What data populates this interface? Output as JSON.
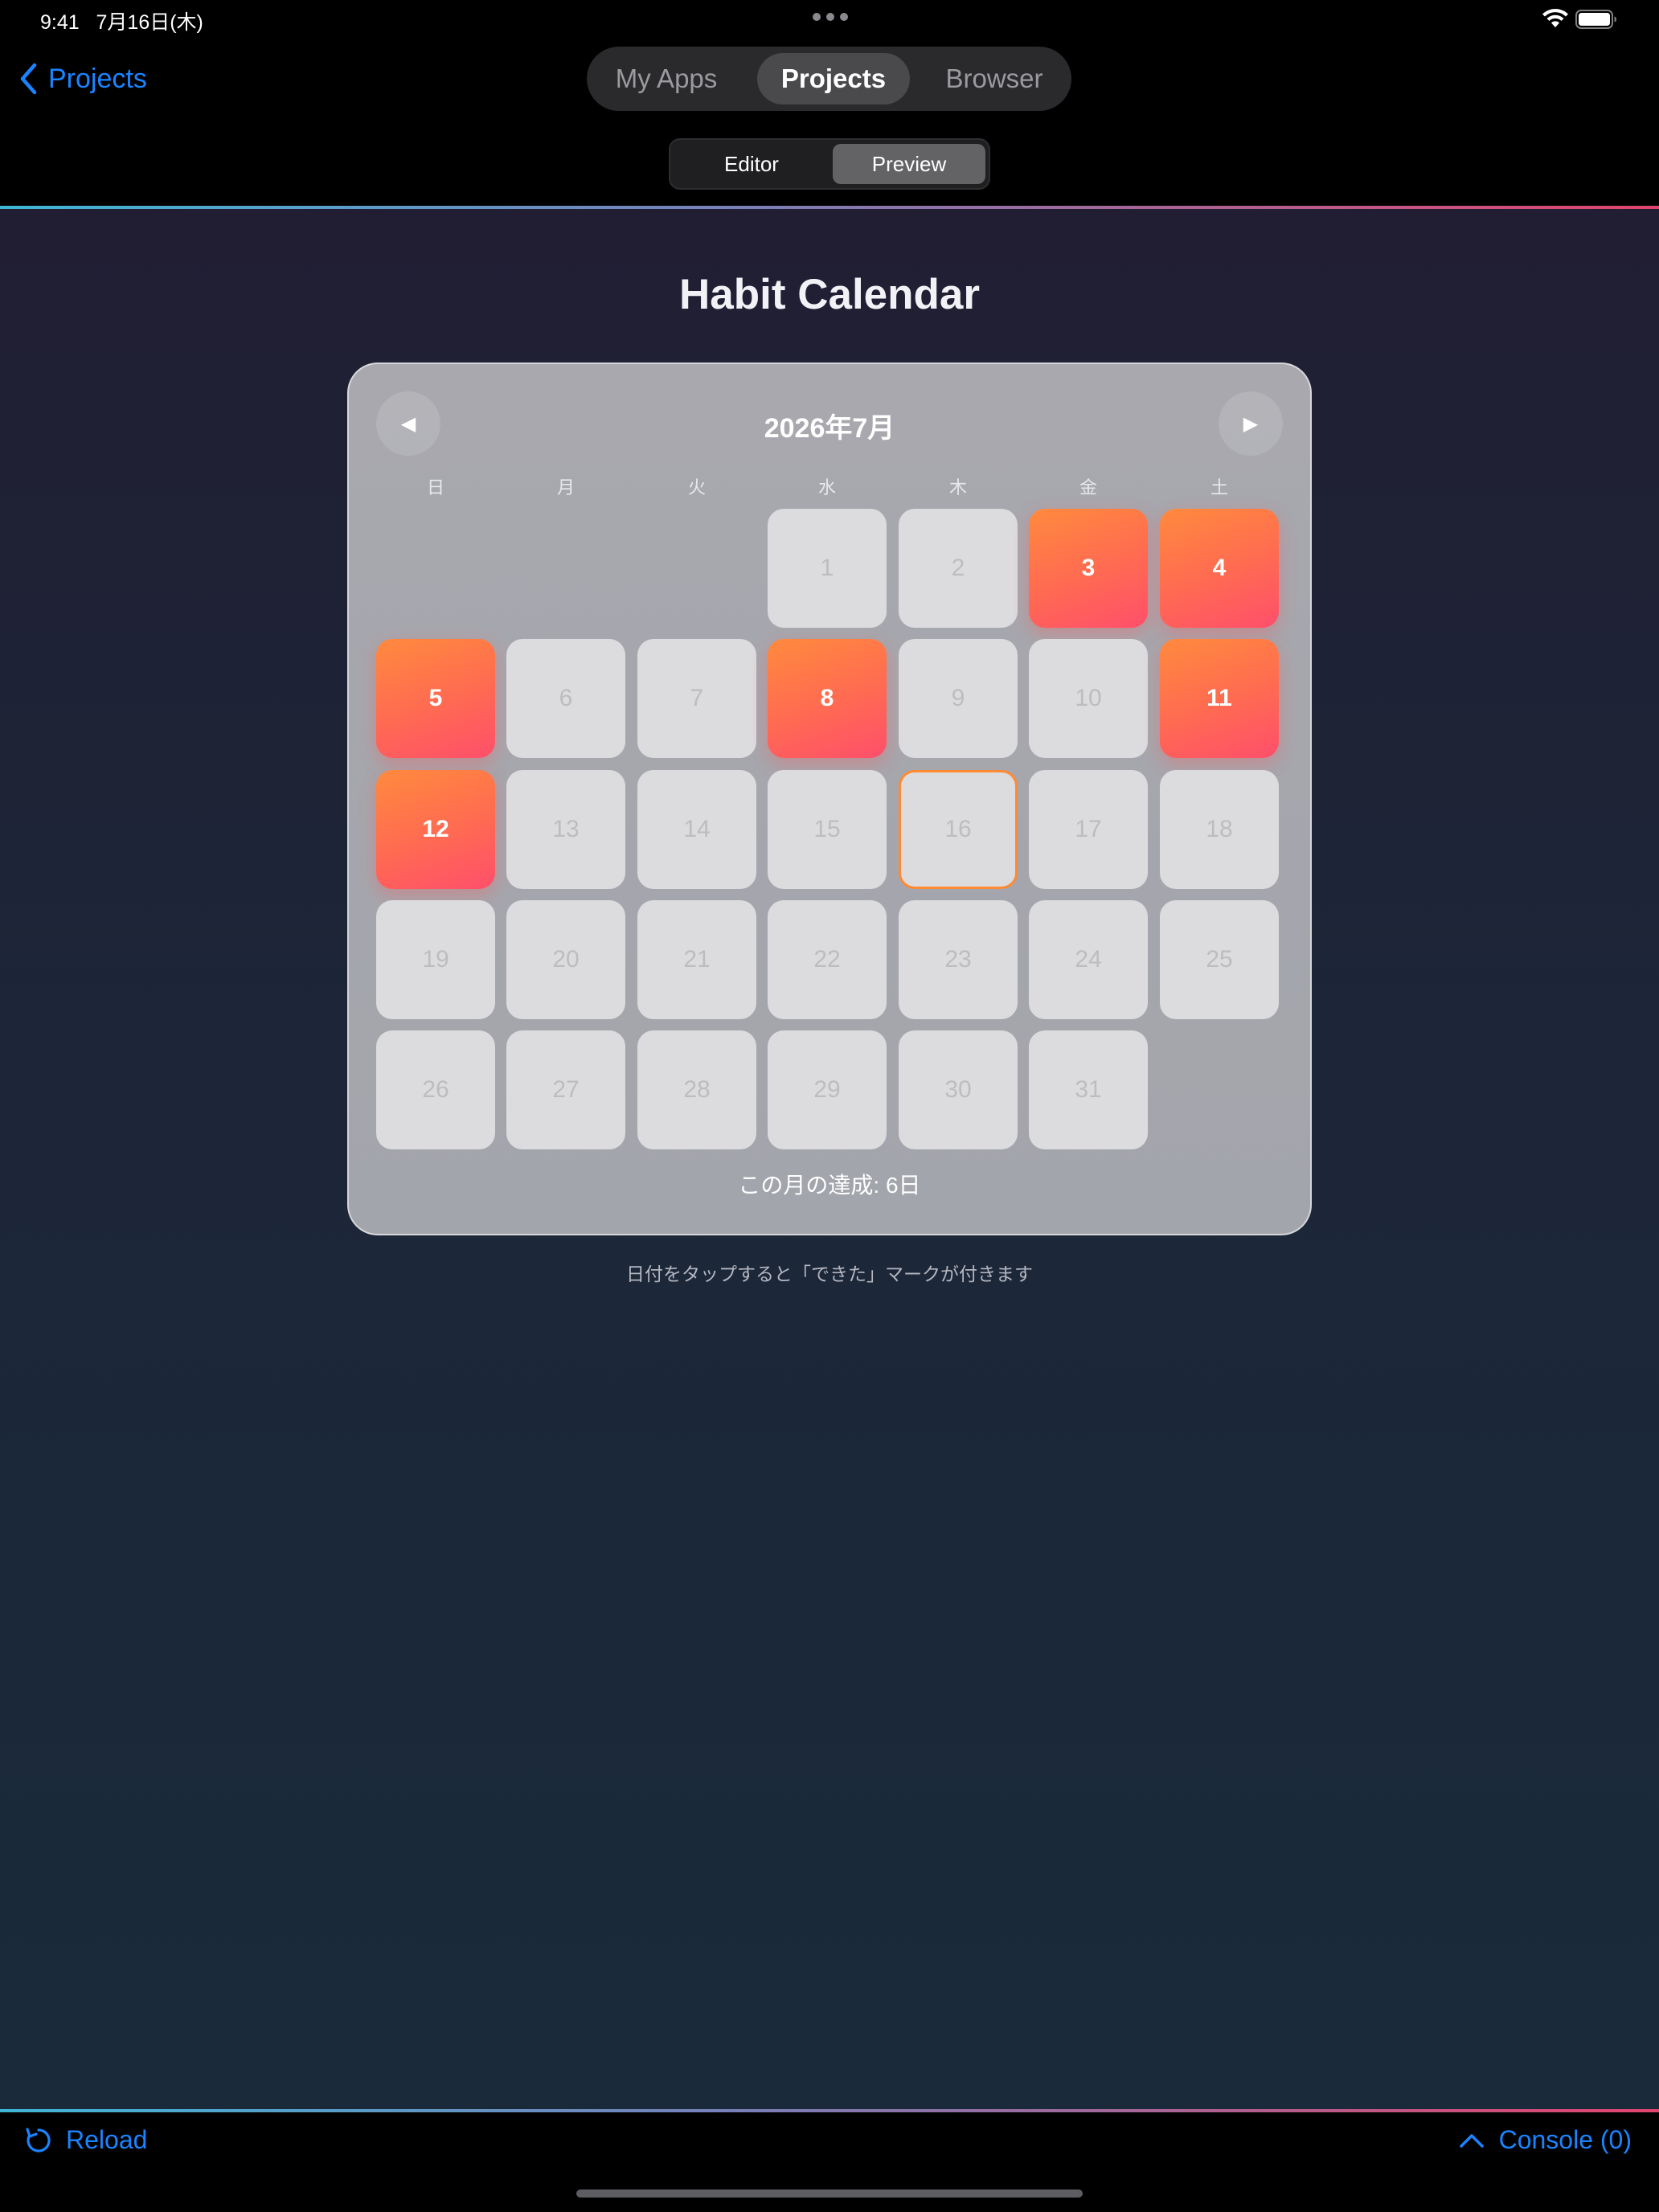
{
  "status_bar": {
    "time": "9:41",
    "date": "7月16日(木)"
  },
  "nav": {
    "back_label": "Projects",
    "tabs": [
      {
        "label": "My Apps",
        "active": false
      },
      {
        "label": "Projects",
        "active": true
      },
      {
        "label": "Browser",
        "active": false
      }
    ],
    "modes": [
      {
        "label": "Editor",
        "active": false
      },
      {
        "label": "Preview",
        "active": true
      }
    ]
  },
  "app": {
    "title": "Habit Calendar",
    "month_title": "2026年7月",
    "prev_icon": "◀",
    "next_icon": "▶",
    "weekdays": [
      "日",
      "月",
      "火",
      "水",
      "木",
      "金",
      "土"
    ],
    "first_weekday_index": 3,
    "days_in_month": 31,
    "completed_days": [
      3,
      4,
      5,
      8,
      11,
      12
    ],
    "today": 16,
    "summary": "この月の達成: 6日",
    "hint": "日付をタップすると「できた」マークが付きます"
  },
  "bottom_bar": {
    "reload_label": "Reload",
    "console_label": "Console (0)"
  },
  "colors": {
    "accent_blue": "#1a84ff",
    "done_gradient_start": "#ff8a3d",
    "done_gradient_end": "#ff4f6b",
    "today_border": "#ff8a32"
  }
}
